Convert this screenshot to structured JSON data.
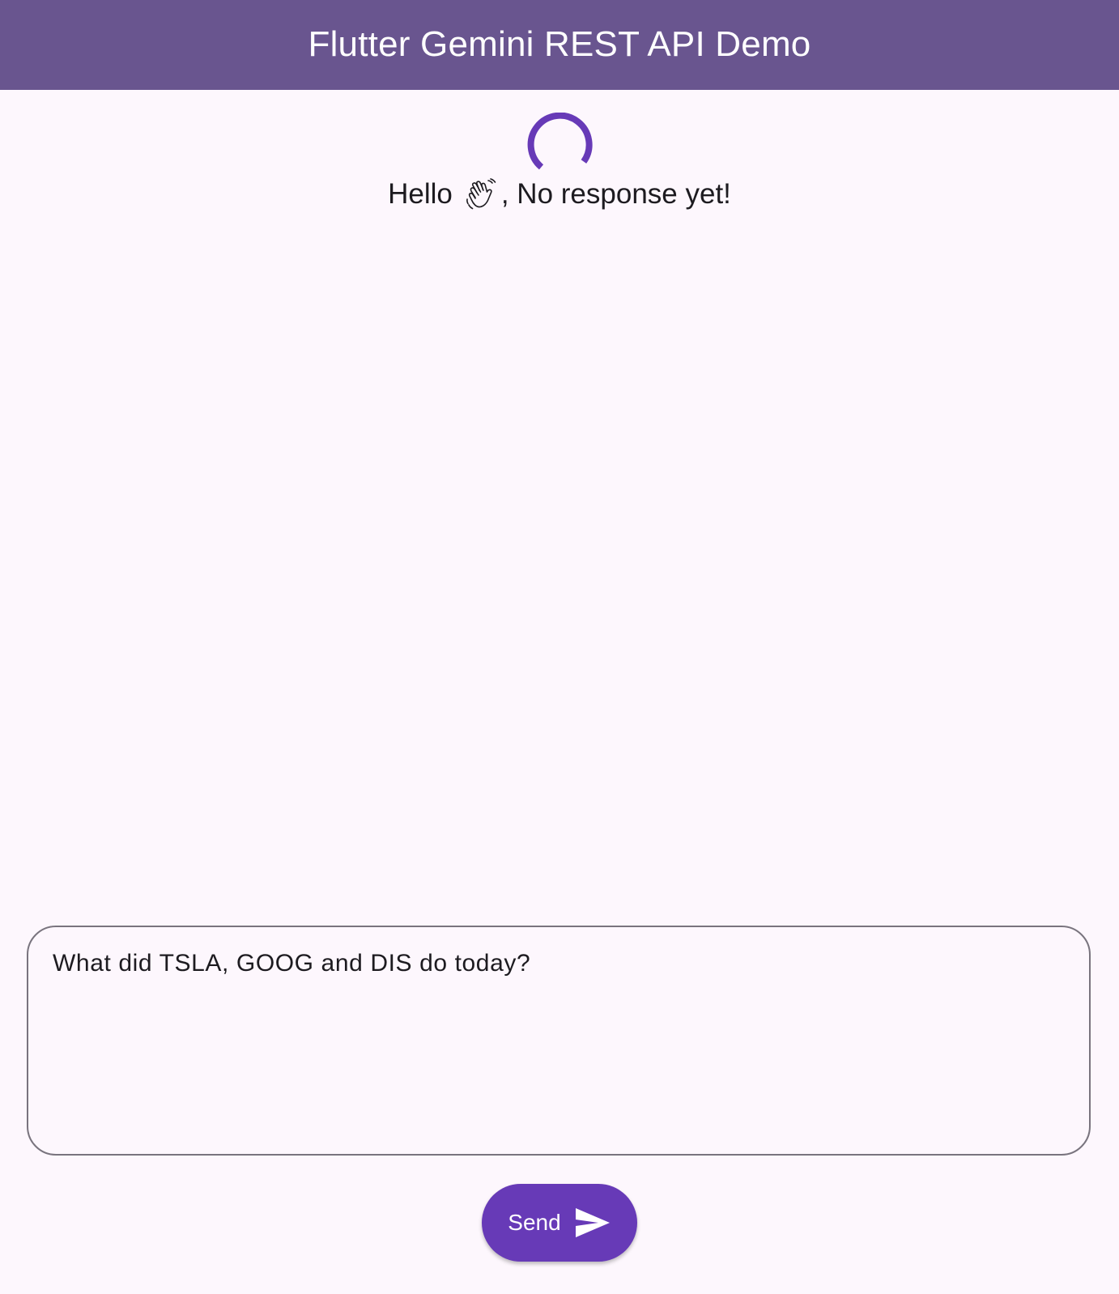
{
  "app_bar": {
    "title": "Flutter Gemini REST API Demo",
    "background_color": "#69558f"
  },
  "status": {
    "loading_indicator": "circular-progress-spinner",
    "greeting_prefix": "Hello",
    "greeting_emoji_icon": "waving-hand-icon",
    "greeting_suffix": ", No response yet!"
  },
  "prompt": {
    "value": "What did TSLA, GOOG and DIS do today?"
  },
  "send_button": {
    "label": "Send",
    "icon": "send-icon",
    "color": "#673ab7"
  },
  "theme": {
    "background": "#fdf7fd",
    "accent": "#673ab7"
  }
}
